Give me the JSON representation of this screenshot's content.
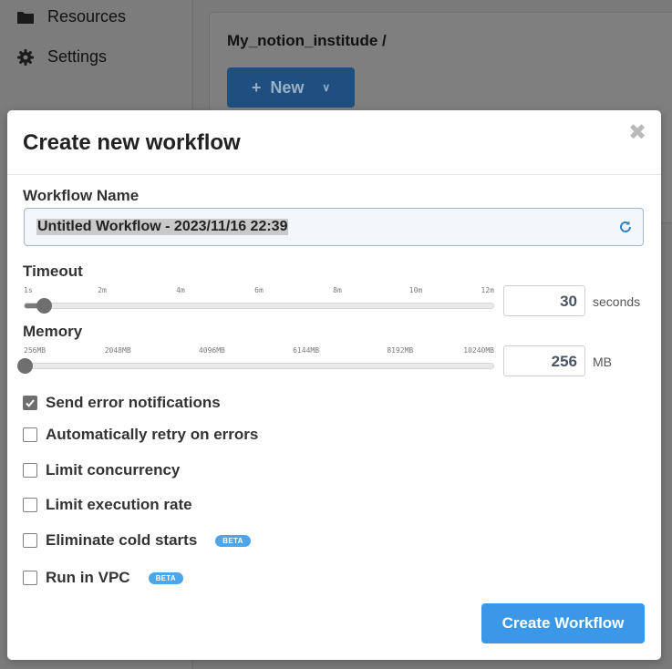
{
  "sidebar": {
    "items": [
      {
        "label": "Resources",
        "icon": "folder-icon"
      },
      {
        "label": "Settings",
        "icon": "gear-icon"
      }
    ]
  },
  "workspace": {
    "breadcrumb": "My_notion_institude /",
    "new_button_label": "New"
  },
  "modal": {
    "title": "Create new workflow",
    "name_label": "Workflow Name",
    "name_value": "Untitled Workflow - 2023/11/16 22:39",
    "timeout": {
      "label": "Timeout",
      "ticks": [
        "1s",
        "2m",
        "4m",
        "6m",
        "8m",
        "10m",
        "12m"
      ],
      "value": "30",
      "unit": "seconds",
      "slider_fraction": 0.04
    },
    "memory": {
      "label": "Memory",
      "ticks": [
        "256MB",
        "2048MB",
        "4096MB",
        "6144MB",
        "8192MB",
        "10240MB"
      ],
      "value": "256",
      "unit": "MB",
      "slider_fraction": 0.0
    },
    "options": [
      {
        "label": "Send error notifications",
        "checked": true
      },
      {
        "label": "Automatically retry on errors",
        "checked": false
      },
      {
        "label": "Limit concurrency",
        "checked": false
      },
      {
        "label": "Limit execution rate",
        "checked": false
      },
      {
        "label": "Eliminate cold starts",
        "checked": false,
        "badge": "BETA"
      },
      {
        "label": "Run in VPC",
        "checked": false,
        "badge": "BETA"
      }
    ],
    "submit_label": "Create Workflow"
  },
  "colors": {
    "accent": "#3b98e8",
    "badge": "#4ea6ea",
    "overlay": "#7d7d7d"
  }
}
